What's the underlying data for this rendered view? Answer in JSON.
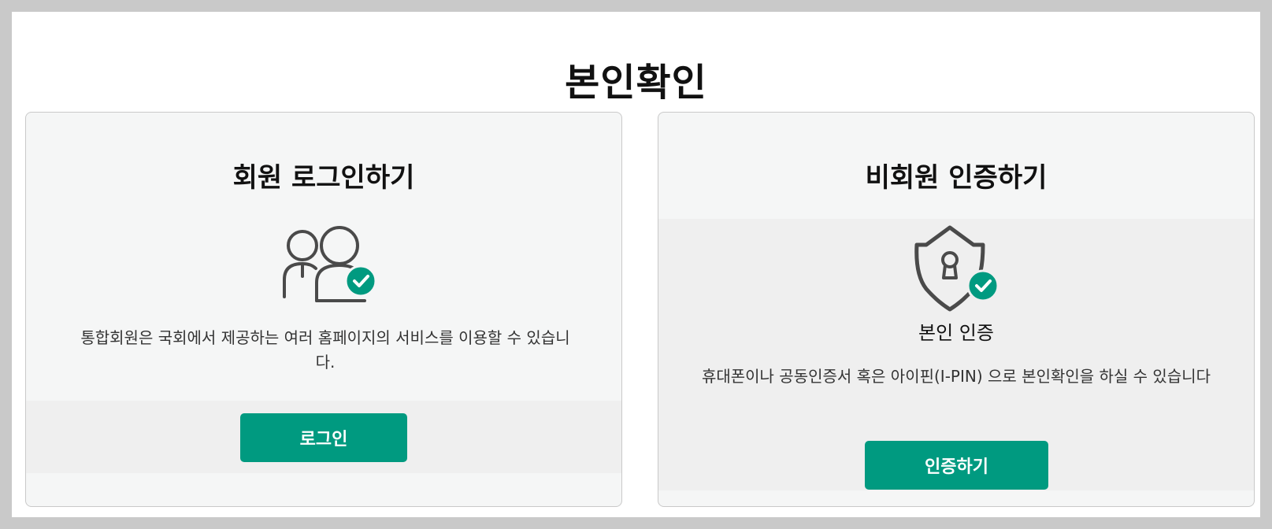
{
  "page": {
    "title": "본인확인"
  },
  "member": {
    "title": "회원 로그인하기",
    "icon": "users-check-icon",
    "description": "통합회원은 국회에서 제공하는 여러 홈페이지의 서비스를 이용할 수 있습니다.",
    "button_label": "로그인"
  },
  "nonmember": {
    "title": "비회원 인증하기",
    "icon": "shield-keyhole-check-icon",
    "subtitle": "본인 인증",
    "description": "휴대폰이나 공동인증서 혹은 아이핀(I-PIN) 으로 본인확인을 하실 수 있습니다",
    "button_label": "인증하기"
  },
  "colors": {
    "accent": "#009a80",
    "page_bg": "#c9c9c9",
    "card_bg": "#f5f6f6",
    "band_bg": "#efefef",
    "icon_stroke": "#4a4a4a"
  }
}
